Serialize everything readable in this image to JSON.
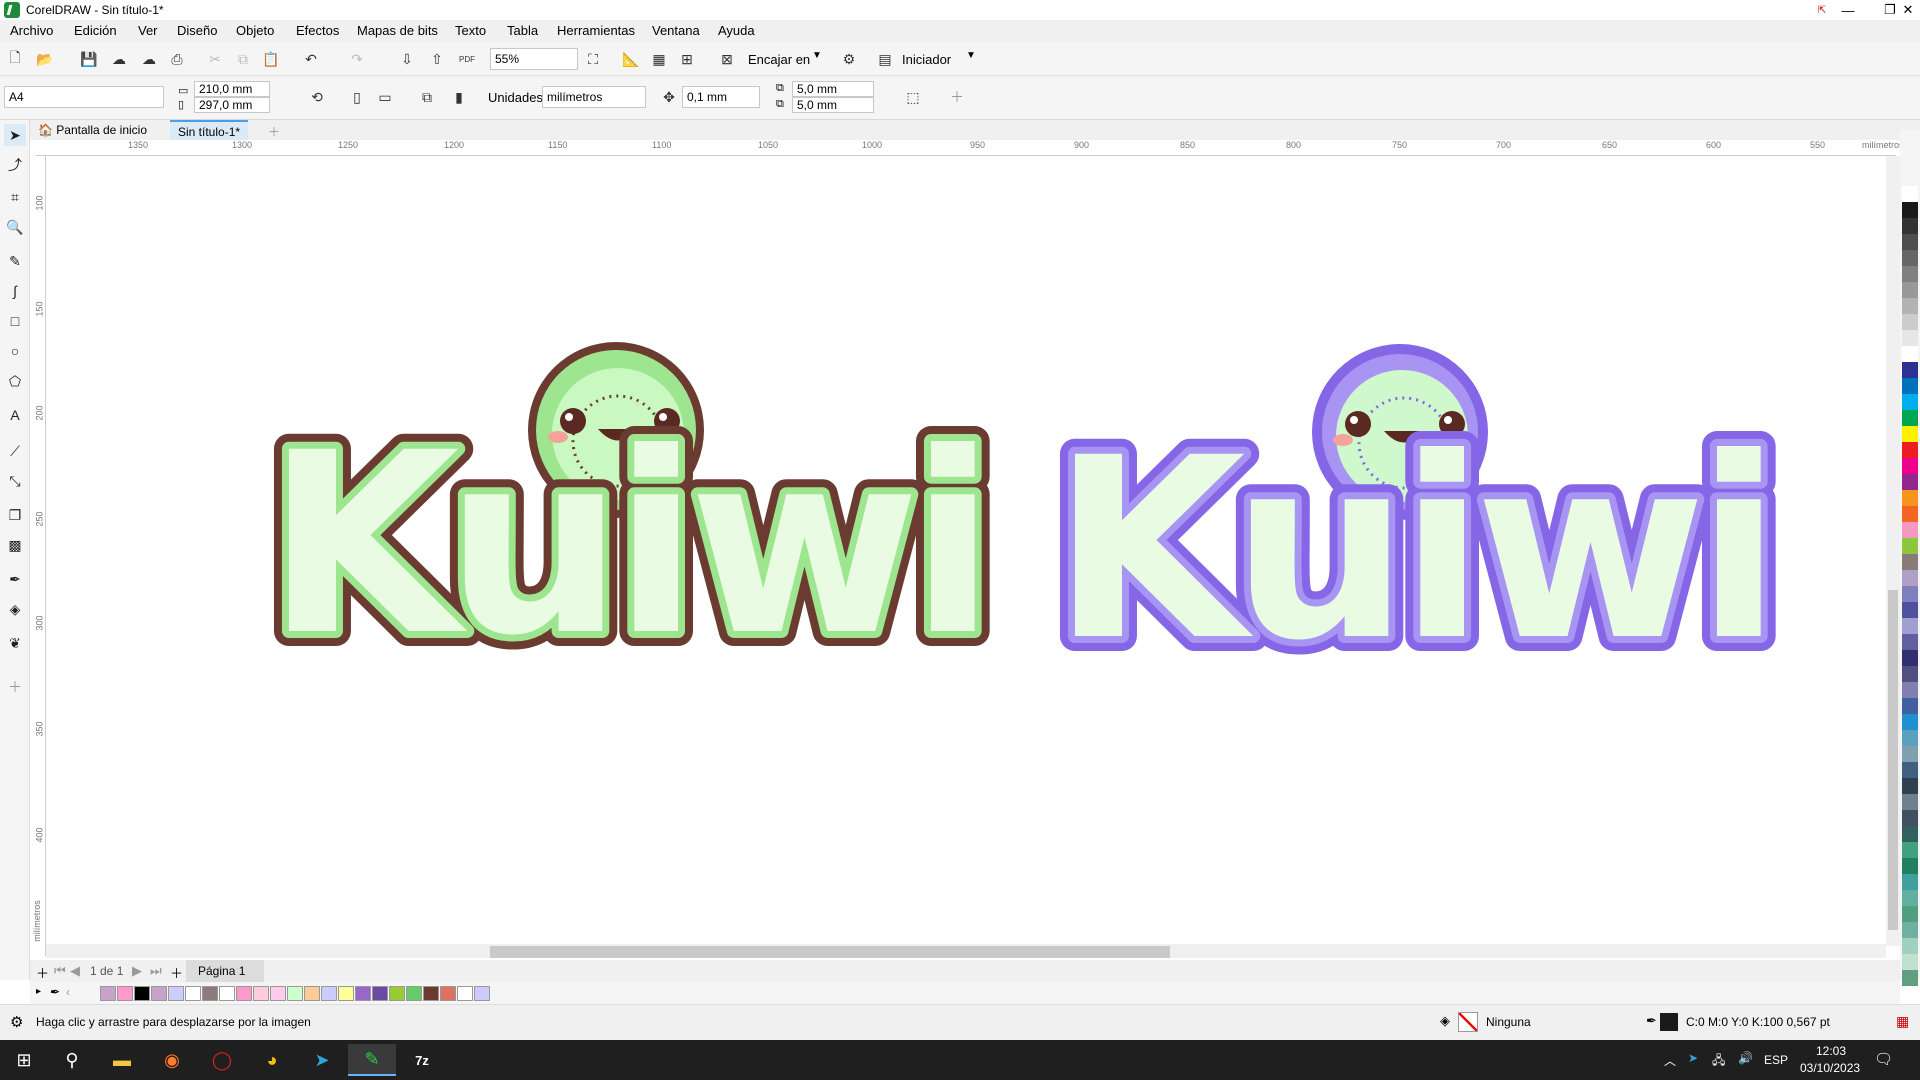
{
  "window": {
    "title": "CorelDRAW - Sin título-1*",
    "min": "—",
    "restore": "❐",
    "close": "✕",
    "pin": "⇱"
  },
  "menu": [
    "Archivo",
    "Edición",
    "Ver",
    "Diseño",
    "Objeto",
    "Efectos",
    "Mapas de bits",
    "Texto",
    "Tabla",
    "Herramientas",
    "Ventana",
    "Ayuda"
  ],
  "toolbar1": {
    "zoom": "55%",
    "snap_label": "Encajar en",
    "launcher_label": "Iniciador",
    "pdf_label": "PDF"
  },
  "toolbar2": {
    "page_size": "A4",
    "width": "210,0 mm",
    "height": "297,0 mm",
    "units_label": "Unidades:",
    "units": "milímetros",
    "nudge": "0,1 mm",
    "dup_x": "5,0 mm",
    "dup_y": "5,0 mm"
  },
  "tabs": [
    "Pantalla de inicio",
    "Sin título-1*"
  ],
  "ruler": {
    "h_ticks": [
      "1350",
      "1300",
      "1250",
      "1200",
      "1150",
      "1100",
      "1050",
      "1000",
      "950",
      "900",
      "850",
      "800",
      "750",
      "700",
      "650",
      "600",
      "550"
    ],
    "h_unit": "milímetros",
    "v_ticks": [
      "100",
      "150",
      "200",
      "250",
      "300",
      "350",
      "400"
    ],
    "v_unit": "milímetros"
  },
  "logos": [
    {
      "text": "Kuiwi",
      "outline": "#6b3b32",
      "fill_outer": "#9de68f",
      "fill_inner": "#e9fbe3",
      "face": "#a9f0a0",
      "face_inner": "#c9f8c0",
      "eye": "#5a2a22",
      "cheek": "#f4a39a"
    },
    {
      "text": "Kuiwi",
      "outline": "#8466e6",
      "fill_outer": "#a894f2",
      "fill_inner": "#e9fbe3",
      "face": "#b9f0b8",
      "face_inner": "#d0f8cd",
      "eye": "#5a2a22",
      "cheek": "#f4a39a"
    }
  ],
  "pagebar": {
    "page_count": "1 de 1",
    "page_tab": "Página 1"
  },
  "status": {
    "hint": "Haga clic y arrastre para desplazarse por la imagen",
    "fill_label": "Ninguna",
    "outline_info": "C:0 M:0 Y:0 K:100  0,567 pt"
  },
  "tray": {
    "lang": "ESP",
    "time": "12:03",
    "date": "03/10/2023"
  },
  "colors": {
    "accent": "#4aa0e6",
    "taskbar": "#1f1f1f"
  },
  "right_palette": [
    "#ffffff",
    "#1a1a1a",
    "#333333",
    "#4d4d4d",
    "#666666",
    "#808080",
    "#999999",
    "#b3b3b3",
    "#cccccc",
    "#e6e6e6",
    "#ffffff",
    "#2e3192",
    "#0072bc",
    "#00aeef",
    "#00a651",
    "#fff200",
    "#ed1c24",
    "#ec008c",
    "#92278f",
    "#f7941d",
    "#f26522",
    "#f49ac1",
    "#8dc63f",
    "#8a7a7a",
    "#b0a0c8",
    "#7f7fbf",
    "#5050a0",
    "#a0a0d0",
    "#6060a0",
    "#303070",
    "#505080",
    "#8080b0",
    "#4060a0",
    "#2090d0",
    "#5aa0c0",
    "#80a0b0",
    "#406080",
    "#304050",
    "#708090",
    "#405060",
    "#306060",
    "#40a080",
    "#208060",
    "#40a0a0",
    "#60b0a0",
    "#50a080",
    "#70b0a0",
    "#a0d0c0",
    "#c0e0d0",
    "#60a080"
  ],
  "doc_palette": [
    "#c8a2c8",
    "#ff99cc",
    "#000000",
    "#c8a2c8",
    "#ccccff",
    "#ffffff",
    "#8b7b7b",
    "#ffffff",
    "#ff99cc",
    "#ffccdd",
    "#ffccee",
    "#ccffcc",
    "#ffcc99",
    "#ccccff",
    "#ffff99",
    "#9966cc",
    "#6b4aa6",
    "#99cc33",
    "#66cc66",
    "#6b3b32",
    "#e07060",
    "#ffffff",
    "#ccccff"
  ]
}
